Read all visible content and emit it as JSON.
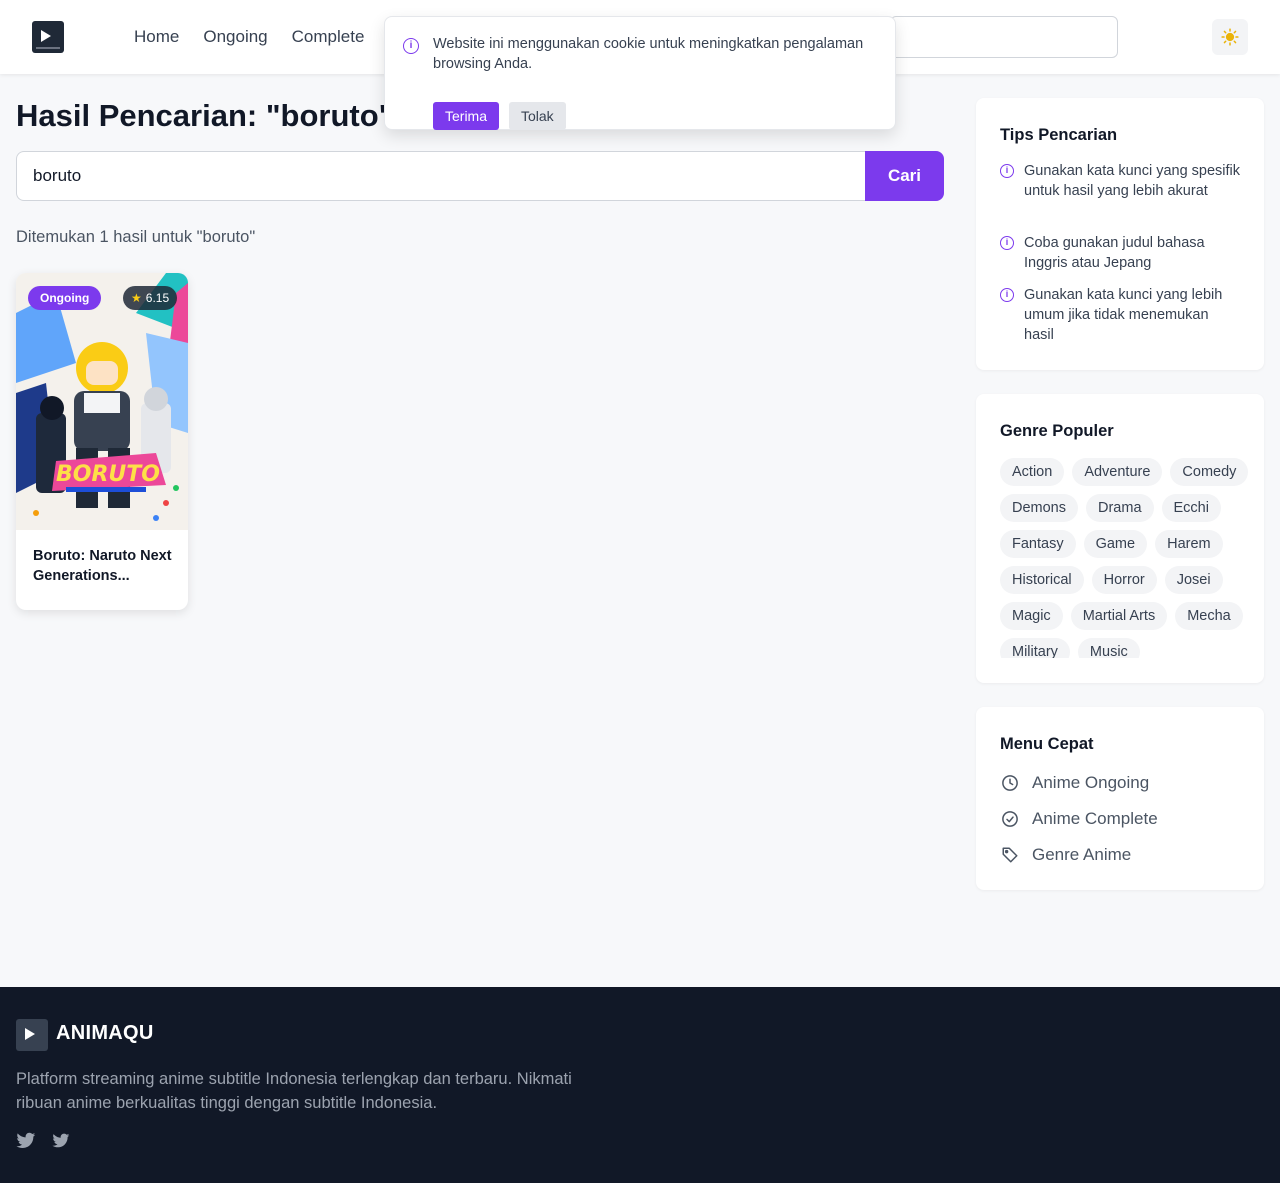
{
  "header": {
    "nav": [
      "Home",
      "Ongoing",
      "Complete"
    ],
    "theme_icon": "sun-icon"
  },
  "cookie": {
    "message": "Website ini menggunakan cookie untuk meningkatkan pengalaman browsing Anda.",
    "accept_label": "Terima",
    "reject_label": "Tolak"
  },
  "main": {
    "title": "Hasil Pencarian: \"boruto\"",
    "search_value": "boruto",
    "search_button": "Cari",
    "result_text": "Ditemukan 1 hasil untuk \"boruto\"",
    "results": [
      {
        "title": "Boruto: Naruto Next Generations...",
        "status": "Ongoing",
        "rating": "6.15"
      }
    ]
  },
  "sidebar": {
    "tips_title": "Tips Pencarian",
    "tips": [
      "Gunakan kata kunci yang spesifik untuk hasil yang lebih akurat",
      "Coba gunakan judul bahasa Inggris atau Jepang",
      "Gunakan kata kunci yang lebih umum jika tidak menemukan hasil"
    ],
    "genres_title": "Genre Populer",
    "genres": [
      "Action",
      "Adventure",
      "Comedy",
      "Demons",
      "Drama",
      "Ecchi",
      "Fantasy",
      "Game",
      "Harem",
      "Historical",
      "Horror",
      "Josei",
      "Magic",
      "Martial Arts",
      "Mecha",
      "Military",
      "Music"
    ],
    "quick_title": "Menu Cepat",
    "quick": [
      "Anime Ongoing",
      "Anime Complete",
      "Genre Anime"
    ]
  },
  "footer": {
    "brand": "ANIMAQU",
    "description": "Platform streaming anime subtitle Indonesia terlengkap dan terbaru. Nikmati ribuan anime berkualitas tinggi dengan subtitle Indonesia."
  },
  "colors": {
    "accent": "#7c3aed",
    "footer_bg": "#111827"
  }
}
